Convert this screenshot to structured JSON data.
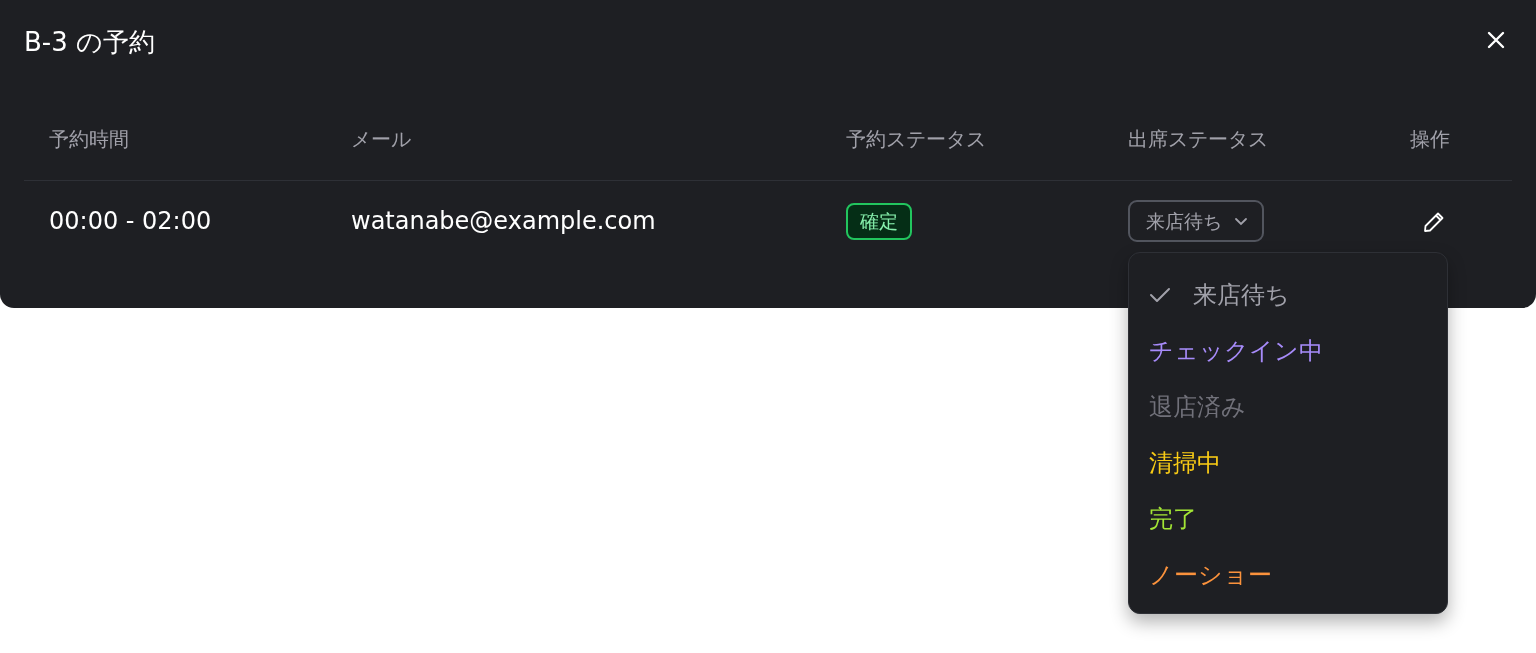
{
  "dialog": {
    "title": "B-3 の予約"
  },
  "table": {
    "columns": [
      "予約時間",
      "メール",
      "予約ステータス",
      "出席ステータス",
      "操作"
    ],
    "rows": [
      {
        "time": "00:00 - 02:00",
        "email": "watanabe@example.com",
        "booking_status": "確定",
        "attendance_status": "来店待ち",
        "menu_open": true
      }
    ]
  },
  "status_menu": {
    "options": [
      {
        "label": "来店待ち",
        "selected": true,
        "color": "#a1a1aa"
      },
      {
        "label": "チェックイン中",
        "selected": false,
        "color": "#a78bfa"
      },
      {
        "label": "退店済み",
        "selected": false,
        "color": "#71717a"
      },
      {
        "label": "清掃中",
        "selected": false,
        "color": "#facc15"
      },
      {
        "label": "完了",
        "selected": false,
        "color": "#a3e635"
      },
      {
        "label": "ノーショー",
        "selected": false,
        "color": "#fb923c"
      }
    ]
  }
}
